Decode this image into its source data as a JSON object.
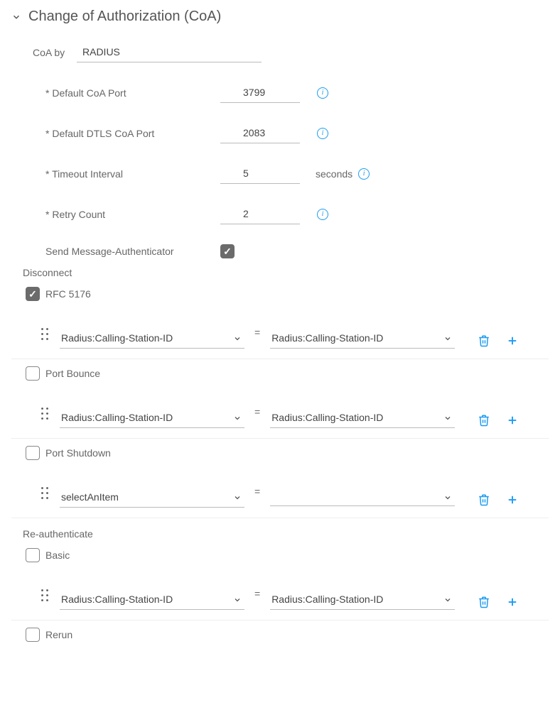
{
  "section": {
    "title": "Change of Authorization (CoA)"
  },
  "coa_by": {
    "label": "CoA by",
    "value": "RADIUS"
  },
  "fields": {
    "default_coa_port": {
      "label": "* Default CoA Port",
      "value": "3799"
    },
    "default_dtls_coa_port": {
      "label": "* Default DTLS CoA Port",
      "value": "2083"
    },
    "timeout_interval": {
      "label": "* Timeout Interval",
      "value": "5",
      "unit": "seconds"
    },
    "retry_count": {
      "label": "* Retry Count",
      "value": "2"
    },
    "send_msg_auth": {
      "label": "Send Message-Authenticator"
    }
  },
  "groups": {
    "disconnect": {
      "header": "Disconnect",
      "rfc5176": {
        "label": "RFC 5176"
      },
      "port_bounce": {
        "label": "Port Bounce"
      },
      "port_shutdown": {
        "label": "Port Shutdown"
      }
    },
    "reauth": {
      "header": "Re-authenticate",
      "basic": {
        "label": "Basic"
      },
      "rerun": {
        "label": "Rerun"
      }
    }
  },
  "attr_rows": [
    {
      "left": "Radius:Calling-Station-ID",
      "right": "Radius:Calling-Station-ID"
    },
    {
      "left": "Radius:Calling-Station-ID",
      "right": "Radius:Calling-Station-ID"
    },
    {
      "left": "selectAnItem",
      "right": ""
    },
    {
      "left": "Radius:Calling-Station-ID",
      "right": "Radius:Calling-Station-ID"
    }
  ],
  "eq": "="
}
